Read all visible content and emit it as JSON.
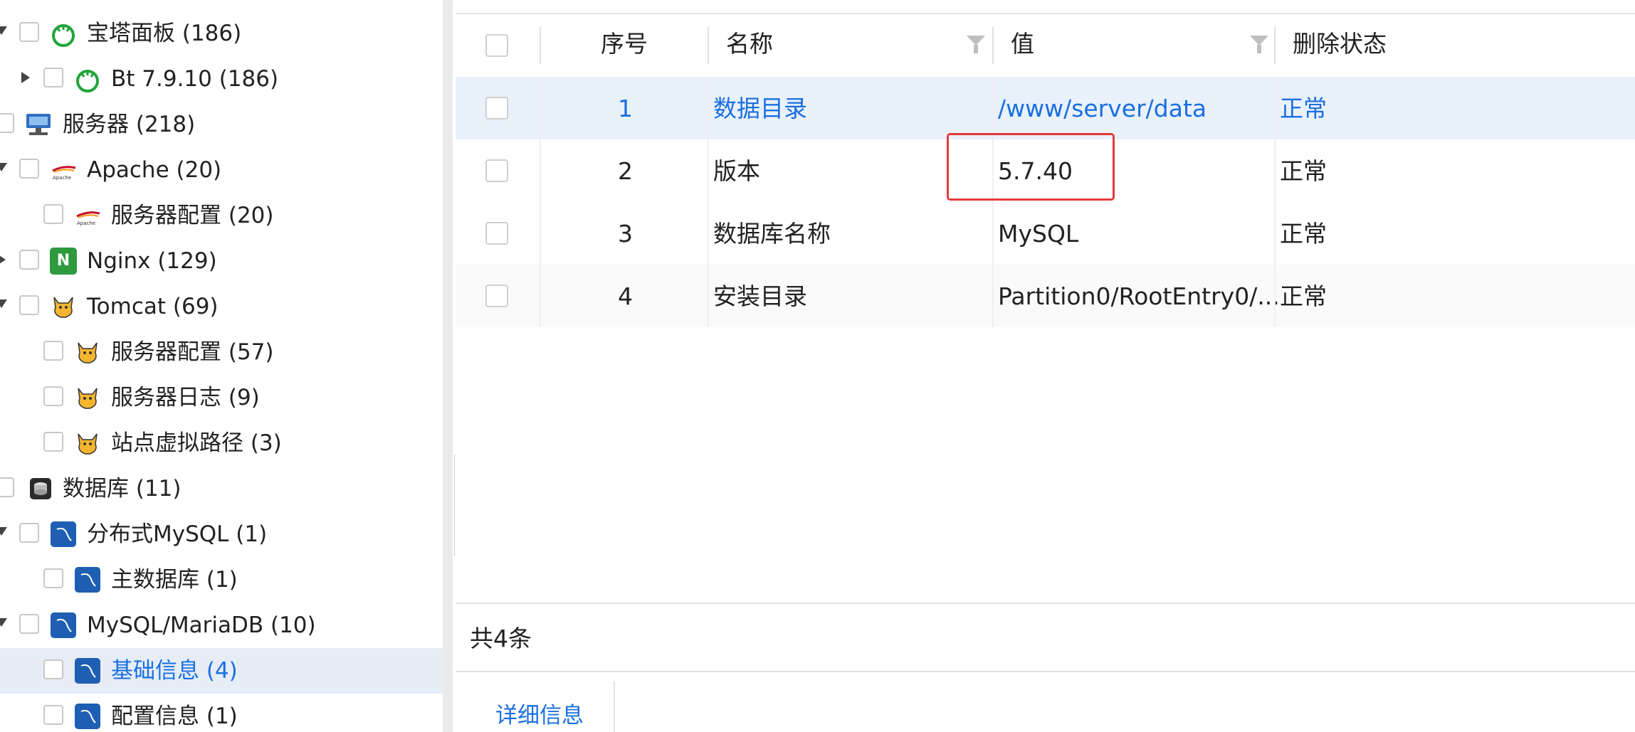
{
  "sidebar": {
    "items": [
      {
        "label": "宝塔面板 (186)",
        "icon": "bt-panel-icon"
      },
      {
        "label": "Bt 7.9.10 (186)",
        "icon": "bt-panel-icon"
      },
      {
        "label": "服务器 (218)",
        "icon": "server-icon"
      },
      {
        "label": "Apache (20)",
        "icon": "apache-icon"
      },
      {
        "label": "服务器配置 (20)",
        "icon": "apache-icon"
      },
      {
        "label": "Nginx (129)",
        "icon": "nginx-icon"
      },
      {
        "label": "Tomcat (69)",
        "icon": "tomcat-icon"
      },
      {
        "label": "服务器配置 (57)",
        "icon": "tomcat-icon"
      },
      {
        "label": "服务器日志 (9)",
        "icon": "tomcat-icon"
      },
      {
        "label": "站点虚拟路径 (3)",
        "icon": "tomcat-icon"
      },
      {
        "label": "数据库 (11)",
        "icon": "database-icon"
      },
      {
        "label": "分布式MySQL (1)",
        "icon": "mysql-icon"
      },
      {
        "label": "主数据库 (1)",
        "icon": "mysql-icon"
      },
      {
        "label": "MySQL/MariaDB (10)",
        "icon": "mysql-icon"
      },
      {
        "label": "基础信息 (4)",
        "icon": "mysql-icon",
        "selected": true
      },
      {
        "label": "配置信息 (1)",
        "icon": "mysql-icon"
      }
    ]
  },
  "table": {
    "headers": {
      "index": "序号",
      "name": "名称",
      "value": "值",
      "status": "删除状态"
    },
    "rows": [
      {
        "index": "1",
        "name": "数据目录",
        "value": "/www/server/data",
        "status": "正常"
      },
      {
        "index": "2",
        "name": "版本",
        "value": "5.7.40",
        "status": "正常"
      },
      {
        "index": "3",
        "name": "数据库名称",
        "value": "MySQL",
        "status": "正常"
      },
      {
        "index": "4",
        "name": "安装目录",
        "value": "Partition0/RootEntry0/...",
        "status": "正常"
      }
    ]
  },
  "footer": {
    "total": "共4条"
  },
  "detail_tabs": {
    "detail": "详细信息"
  },
  "colors": {
    "accent": "#1a6fe0",
    "selected_bg": "#e6edf7",
    "highlight_box": "#e23b3b"
  }
}
